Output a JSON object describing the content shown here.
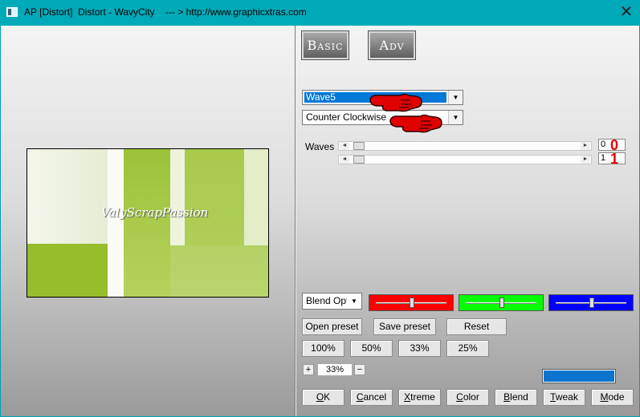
{
  "window": {
    "title": "AP [Distort]  Distort - WavyCity    --- > http://www.graphicxtras.com",
    "close_glyph": "✕"
  },
  "preview": {
    "watermark": "ValyScrapPassion"
  },
  "mode_buttons": {
    "basic": "Basic",
    "adv": "Adv"
  },
  "effect_select": {
    "value": "Wave5"
  },
  "direction_select": {
    "value": "Counter Clockwise"
  },
  "sliders": [
    {
      "label": "Waves",
      "value": "0",
      "annotation": "0"
    },
    {
      "label": "",
      "value": "1",
      "annotation": "1"
    }
  ],
  "blend": {
    "select_value": "Blend Optic",
    "colors": {
      "red": "#ff0000",
      "green": "#00ff00",
      "blue": "#0000ff"
    },
    "channel_levels": {
      "red": 0.5,
      "green": 0.5,
      "blue": 0.5
    }
  },
  "preset_buttons": {
    "open": "Open preset",
    "save": "Save preset",
    "reset": "Reset"
  },
  "zoom_buttons": [
    "100%",
    "50%",
    "33%",
    "25%"
  ],
  "zoom": {
    "plus": "+",
    "minus": "−",
    "value": "33%"
  },
  "swatch_color": "#0a74cf",
  "footer_buttons": [
    {
      "key": "O",
      "rest": "K"
    },
    {
      "key": "",
      "rest": "Cancel",
      "u_first": "C",
      "tail": "ancel"
    },
    {
      "key": "X",
      "rest": "treme"
    },
    {
      "key": "C",
      "rest": "olor"
    },
    {
      "key": "B",
      "rest": "lend"
    },
    {
      "key": "T",
      "rest": "weak"
    },
    {
      "key": "M",
      "rest": "ode"
    }
  ],
  "icons": {
    "hand": "pointing-hand-icon",
    "arrow_down": "▼",
    "arrow_left": "◄",
    "arrow_right": "►"
  }
}
